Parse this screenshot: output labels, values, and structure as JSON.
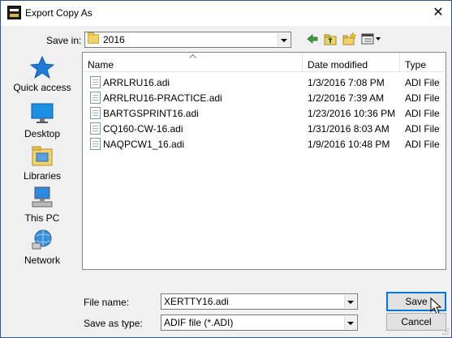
{
  "window": {
    "title": "Export Copy As",
    "close_glyph": "✕"
  },
  "save_in": {
    "label": "Save in:",
    "value": "2016"
  },
  "toolbar": {
    "icons": [
      "back-icon",
      "up-folder-icon",
      "new-folder-icon",
      "view-menu-icon"
    ]
  },
  "places": [
    {
      "label": "Quick access",
      "icon": "star-icon"
    },
    {
      "label": "Desktop",
      "icon": "desktop-icon"
    },
    {
      "label": "Libraries",
      "icon": "libraries-icon"
    },
    {
      "label": "This PC",
      "icon": "computer-icon"
    },
    {
      "label": "Network",
      "icon": "network-icon"
    }
  ],
  "columns": {
    "name": "Name",
    "date": "Date modified",
    "type": "Type"
  },
  "files": [
    {
      "name": "ARRLRU16.adi",
      "date": "1/3/2016 7:08 PM",
      "type": "ADI File"
    },
    {
      "name": "ARRLRU16-PRACTICE.adi",
      "date": "1/2/2016 7:39 AM",
      "type": "ADI File"
    },
    {
      "name": "BARTGSPRINT16.adi",
      "date": "1/23/2016 10:36 PM",
      "type": "ADI File"
    },
    {
      "name": "CQ160-CW-16.adi",
      "date": "1/31/2016 8:03 AM",
      "type": "ADI File"
    },
    {
      "name": "NAQPCW1_16.adi",
      "date": "1/9/2016 10:48 PM",
      "type": "ADI File"
    }
  ],
  "file_name": {
    "label": "File name:",
    "value": "XERTTY16.adi"
  },
  "save_type": {
    "label": "Save as type:",
    "value": "ADIF file (*.ADI)"
  },
  "buttons": {
    "save": "Save",
    "cancel": "Cancel"
  },
  "colors": {
    "accent": "#0078d7",
    "star": "#1e7bd6",
    "folder": "#f4d26a"
  }
}
